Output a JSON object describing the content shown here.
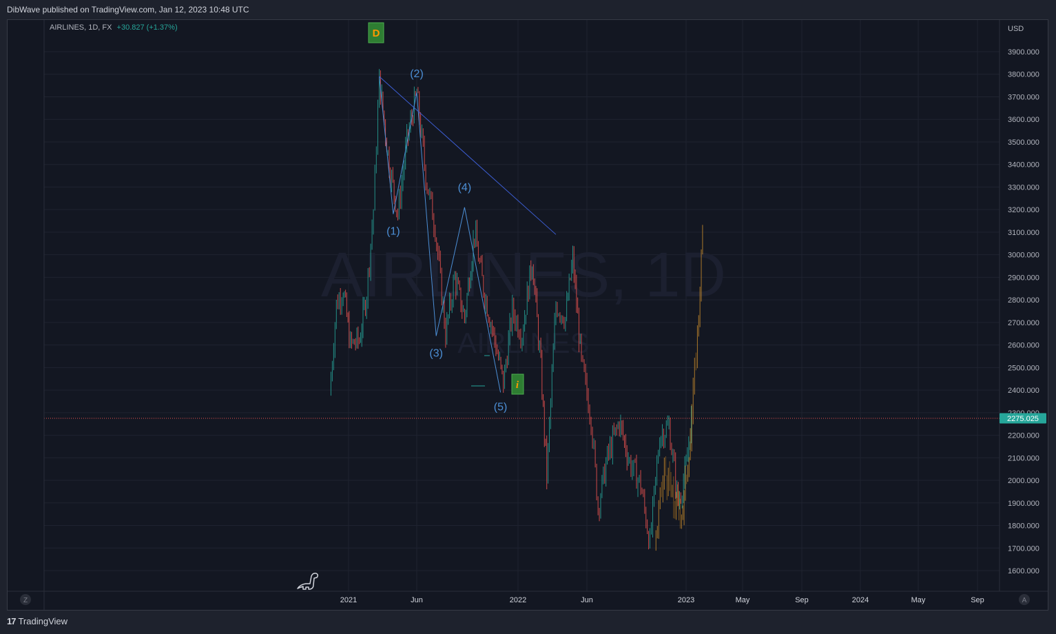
{
  "header": {
    "publisher_line": "DibWave published on TradingView.com, Jan 12, 2023 10:48 UTC"
  },
  "legend": {
    "symbol": "AIRLINES, 1D, FX",
    "change": "+30.827 (+1.37%)"
  },
  "watermark": {
    "main": "AIRLINES, 1D",
    "sub": "AIRLINES"
  },
  "price_axis": {
    "currency": "USD",
    "labels": [
      "3900.000",
      "3800.000",
      "3700.000",
      "3600.000",
      "3500.000",
      "3400.000",
      "3300.000",
      "3200.000",
      "3100.000",
      "3000.000",
      "2900.000",
      "2800.000",
      "2700.000",
      "2600.000",
      "2500.000",
      "2400.000",
      "2300.000",
      "2200.000",
      "2100.000",
      "2000.000",
      "1900.000",
      "1800.000",
      "1700.000",
      "1600.000"
    ],
    "last_price": "2275.025"
  },
  "time_axis": {
    "labels": [
      "2021",
      "Jun",
      "2022",
      "Jun",
      "2023",
      "May",
      "Sep",
      "2024",
      "May",
      "Sep"
    ]
  },
  "wave_labels": [
    "(1)",
    "(2)",
    "(3)",
    "(4)",
    "(5)"
  ],
  "markers": {
    "d_badge": "D",
    "i_badge": "i"
  },
  "buttons": {
    "zoom_left": "Z",
    "auto_scale": "A"
  },
  "footer": {
    "brand": "TradingView",
    "logo": "17"
  },
  "colors": {
    "background": "#131722",
    "grid": "#1f2330",
    "up": "#26a69a",
    "down": "#ef5350",
    "wave": "#4c8fd6",
    "trendline": "#3d5fd6",
    "projection": "#c68a2c",
    "last_price_badge": "#26a69a",
    "badge_fill": "#2e7d32",
    "badge_text": "#ff9800"
  },
  "chart_data": {
    "type": "line",
    "title": "",
    "xlabel": "",
    "ylabel": "USD",
    "ylim": [
      1550,
      3950
    ],
    "price_path": [
      [
        "2020-11-20",
        2380
      ],
      [
        "2020-12-05",
        2780
      ],
      [
        "2020-12-20",
        2850
      ],
      [
        "2021-01-05",
        2600
      ],
      [
        "2021-01-25",
        2620
      ],
      [
        "2021-02-10",
        2830
      ],
      [
        "2021-02-25",
        3200
      ],
      [
        "2021-03-10",
        3780
      ],
      [
        "2021-04-01",
        3400
      ],
      [
        "2021-04-20",
        3180
      ],
      [
        "2021-05-10",
        3500
      ],
      [
        "2021-06-01",
        3720
      ],
      [
        "2021-06-20",
        3350
      ],
      [
        "2021-07-10",
        3120
      ],
      [
        "2021-08-01",
        2650
      ],
      [
        "2021-08-20",
        2900
      ],
      [
        "2021-09-10",
        2720
      ],
      [
        "2021-10-01",
        3100
      ],
      [
        "2021-10-20",
        2850
      ],
      [
        "2021-11-10",
        2650
      ],
      [
        "2021-12-01",
        2430
      ],
      [
        "2021-12-20",
        2750
      ],
      [
        "2022-01-10",
        2650
      ],
      [
        "2022-02-01",
        2980
      ],
      [
        "2022-02-20",
        2500
      ],
      [
        "2022-03-05",
        2020
      ],
      [
        "2022-03-25",
        2780
      ],
      [
        "2022-04-15",
        2720
      ],
      [
        "2022-05-01",
        2980
      ],
      [
        "2022-05-20",
        2520
      ],
      [
        "2022-06-10",
        2280
      ],
      [
        "2022-06-25",
        1880
      ],
      [
        "2022-07-15",
        2100
      ],
      [
        "2022-08-10",
        2260
      ],
      [
        "2022-09-01",
        2080
      ],
      [
        "2022-09-25",
        1980
      ],
      [
        "2022-10-15",
        1720
      ],
      [
        "2022-11-05",
        2200
      ],
      [
        "2022-11-25",
        2240
      ],
      [
        "2022-12-15",
        1900
      ],
      [
        "2023-01-01",
        2050
      ],
      [
        "2023-01-12",
        2275
      ]
    ],
    "projection_path": [
      [
        "2022-10-25",
        1700
      ],
      [
        "2022-11-15",
        2050
      ],
      [
        "2022-12-05",
        1900
      ],
      [
        "2022-12-25",
        1870
      ],
      [
        "2023-01-10",
        2200
      ],
      [
        "2023-01-25",
        2650
      ],
      [
        "2023-02-05",
        3080
      ]
    ],
    "waves": [
      {
        "label": "(1)",
        "date": "2021-04-10",
        "price": 3180
      },
      {
        "label": "(2)",
        "date": "2021-06-01",
        "price": 3720
      },
      {
        "label": "(3)",
        "date": "2021-07-12",
        "price": 2640
      },
      {
        "label": "(4)",
        "date": "2021-09-10",
        "price": 3210
      },
      {
        "label": "(5)",
        "date": "2021-11-25",
        "price": 2390
      }
    ],
    "trendline": [
      [
        "2021-03-10",
        3790
      ],
      [
        "2022-03-25",
        3090
      ]
    ],
    "last_price": 2275.025
  }
}
